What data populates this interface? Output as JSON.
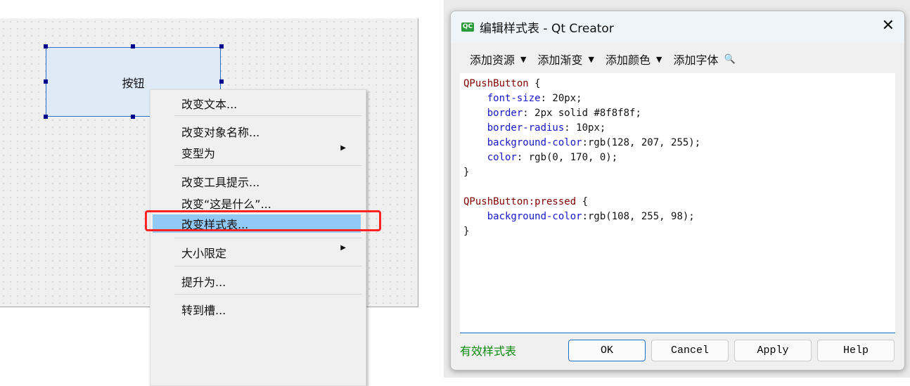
{
  "designer": {
    "widget_text": "按钮"
  },
  "context_menu": {
    "items": [
      {
        "label": "改变文本..."
      },
      {
        "label": "改变对象名称..."
      },
      {
        "label": "变型为",
        "submenu": true
      },
      {
        "label": "改变工具提示..."
      },
      {
        "label": "改变“这是什么”..."
      },
      {
        "label": "改变样式表...",
        "highlighted": true
      },
      {
        "label": "大小限定",
        "submenu": true
      },
      {
        "label": "提升为..."
      },
      {
        "label": "转到槽..."
      }
    ]
  },
  "dialog": {
    "title": "编辑样式表 - Qt Creator",
    "app_icon": "QC",
    "toolbar": [
      {
        "label": "添加资源"
      },
      {
        "label": "添加渐变"
      },
      {
        "label": "添加颜色"
      },
      {
        "label": "添加字体"
      }
    ],
    "code_lines": [
      [
        {
          "t": "QPushButton",
          "c": "sel"
        },
        {
          "t": " {",
          "c": "val"
        }
      ],
      [
        {
          "t": "    font-size",
          "c": "prop"
        },
        {
          "t": ": 20px;",
          "c": "val"
        }
      ],
      [
        {
          "t": "    border",
          "c": "prop"
        },
        {
          "t": ": 2px solid #8f8f8f;",
          "c": "val"
        }
      ],
      [
        {
          "t": "    border-radius",
          "c": "prop"
        },
        {
          "t": ": 10px;",
          "c": "val"
        }
      ],
      [
        {
          "t": "    background-color",
          "c": "prop"
        },
        {
          "t": ":rgb(128, 207, 255);",
          "c": "val"
        }
      ],
      [
        {
          "t": "    color",
          "c": "prop"
        },
        {
          "t": ": rgb(0, 170, 0);",
          "c": "val"
        }
      ],
      [
        {
          "t": "}",
          "c": "val"
        }
      ],
      [
        {
          "t": "",
          "c": "val"
        }
      ],
      [
        {
          "t": "QPushButton:pressed",
          "c": "sel"
        },
        {
          "t": " {",
          "c": "val"
        }
      ],
      [
        {
          "t": "    background-color",
          "c": "prop"
        },
        {
          "t": ":rgb(108, 255, 98);",
          "c": "val"
        }
      ],
      [
        {
          "t": "}",
          "c": "val"
        }
      ]
    ],
    "status": "有效样式表",
    "buttons": {
      "ok": "OK",
      "cancel": "Cancel",
      "apply": "Apply",
      "help": "Help"
    },
    "colors": {
      "status": "#0a8a0a",
      "selector": "#800000",
      "property": "#1515c8",
      "highlight": "#91c9f7",
      "annotation": "#ff2222"
    }
  }
}
